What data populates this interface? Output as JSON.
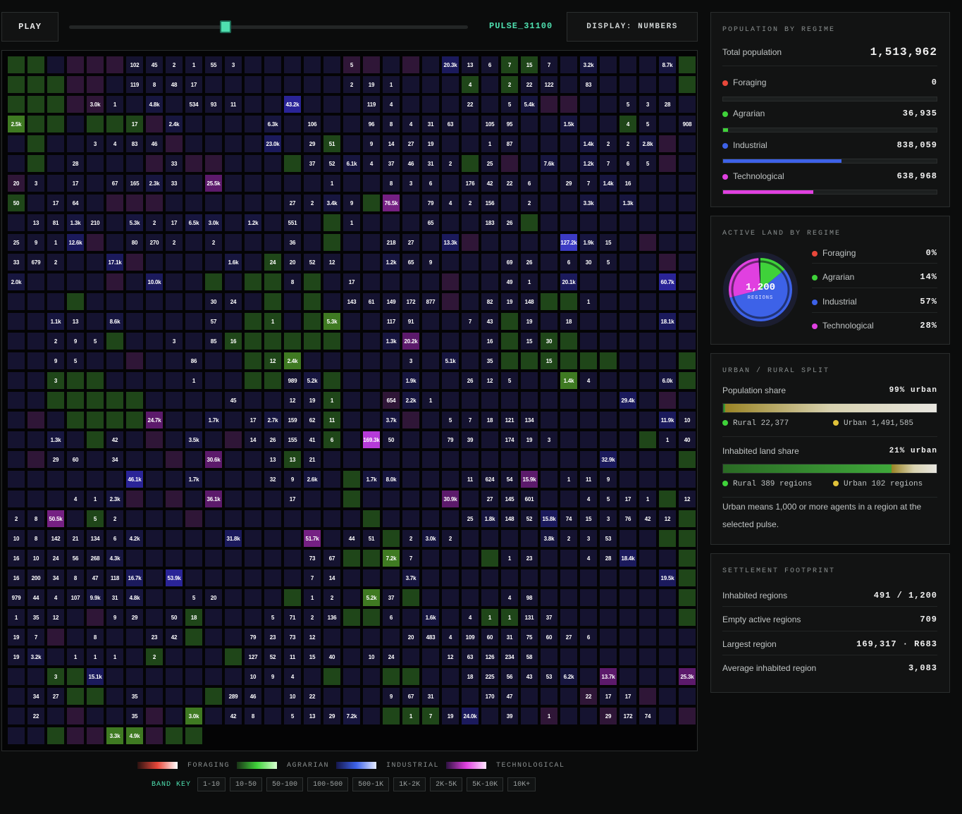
{
  "controls": {
    "play_label": "PLAY",
    "slider_value": 0.393,
    "pulse_label": "PULSE_31100",
    "display_label": "DISPLAY: NUMBERS"
  },
  "colors": {
    "foraging": "#e8473a",
    "agrarian": "#3fd23a",
    "industrial": "#3d62e8",
    "technological": "#e040e0",
    "accent": "#4fe0b0",
    "urban": "#e0c23a"
  },
  "grid": {
    "cols": 35,
    "rows": 35,
    "cells": [
      "G,",
      "G,",
      "I,",
      "T,",
      "T,",
      "T,",
      "I,102",
      "I,45",
      "I,2",
      "I,1",
      "I,55",
      "I,3",
      "I,",
      "I,",
      "I,",
      "I,",
      "I,",
      "T,5",
      "T,",
      "I,",
      "T,",
      "I,",
      "I,20.3k",
      "I,13",
      "I,6",
      "G,7",
      "G,15",
      "I,7",
      "I,",
      "I,3.2k",
      "I,",
      "I,",
      "I,",
      "I,8.7k",
      "G,",
      "G,",
      "G,",
      "G,",
      "T,",
      "T,",
      "I,",
      "I,119",
      "I,8",
      "I,48",
      "I,17",
      "I,",
      "I,",
      "I,",
      "I,",
      "I,",
      "I,",
      "I,",
      "I,2",
      "I,19",
      "I,1",
      "I,",
      "I,",
      "I,",
      "G,4",
      "I,",
      "G,2",
      "I,22",
      "I,122",
      "I,",
      "I,83",
      "I,",
      "I,",
      "I,",
      "I,",
      "G,",
      "G,",
      "G,",
      "G,",
      "T,",
      "T,3.0k",
      "I,1",
      "I,",
      "I,4.8k",
      "I,",
      "I,534",
      "I,93",
      "I,11",
      "I,",
      "I,",
      "I,43.2k",
      "I,",
      "I,",
      "I,",
      "I,119",
      "I,4",
      "I,",
      "I,",
      "I,",
      "I,22",
      "I,",
      "I,5",
      "I,5.4k",
      "T,",
      "T,",
      "I,",
      "I,",
      "I,5",
      "I,3",
      "I,28",
      "I,",
      "G,2.5k",
      "G,",
      "G,",
      "I,",
      "G,",
      "G,",
      "G,17",
      "T,",
      "I,2.4k",
      "I,",
      "I,",
      "I,",
      "I,",
      "I,6.3k",
      "I,",
      "I,106",
      "I,",
      "I,",
      "I,96",
      "I,8",
      "I,4",
      "I,31",
      "I,63",
      "I,",
      "I,105",
      "I,95",
      "I,",
      "I,",
      "I,1.5k",
      "I,",
      "I,",
      "G,4",
      "I,5",
      "I,",
      "I,908",
      "I,",
      "G,",
      "I,",
      "I,",
      "I,3",
      "I,4",
      "I,83",
      "I,46",
      "T,",
      "I,",
      "I,",
      "I,",
      "I,",
      "I,23.0k",
      "I,",
      "I,29",
      "G,51",
      "I,",
      "I,9",
      "I,14",
      "I,27",
      "I,19",
      "I,",
      "I,",
      "I,1",
      "I,87",
      "I,",
      "I,",
      "I,",
      "I,1.4k",
      "I,2",
      "I,2",
      "I,2.8k",
      "T,",
      "I,",
      "I,",
      "G,",
      "I,",
      "I,28",
      "I,",
      "I,",
      "I,",
      "T,",
      "I,33",
      "T,",
      "T,",
      "I,",
      "I,",
      "I,",
      "G,",
      "I,37",
      "I,52",
      "I,6.1k",
      "I,4",
      "I,37",
      "I,46",
      "I,31",
      "I,2",
      "G,",
      "I,25",
      "T,",
      "I,",
      "I,7.6k",
      "I,",
      "I,1.2k",
      "I,7",
      "I,6",
      "I,5",
      "T,",
      "I,",
      "T,20",
      "I,3",
      "I,",
      "I,17",
      "I,",
      "I,67",
      "I,165",
      "I,2.3k",
      "I,33",
      "I,",
      "T,25.5k",
      "I,",
      "I,",
      "I,",
      "I,",
      "I,",
      "I,1",
      "I,",
      "I,",
      "I,8",
      "I,3",
      "I,6",
      "I,",
      "I,176",
      "I,42",
      "I,22",
      "I,6",
      "I,",
      "I,29",
      "I,7",
      "I,1.4k",
      "I,16",
      "I,",
      "I,",
      "I,",
      "G,50",
      "I,",
      "I,17",
      "I,64",
      "I,",
      "T,",
      "T,",
      "T,",
      "I,",
      "I,",
      "I,",
      "I,",
      "I,",
      "I,",
      "I,27",
      "I,2",
      "I,3.4k",
      "I,9",
      "G,",
      "T,76.5k",
      "I,",
      "I,79",
      "I,4",
      "I,2",
      "I,156",
      "I,",
      "I,2",
      "I,",
      "I,",
      "I,3.3k",
      "I,",
      "I,1.3k",
      "I,",
      "I,",
      "I,",
      "I,",
      "I,13",
      "I,81",
      "I,1.3k",
      "I,210",
      "I,",
      "I,5.3k",
      "I,2",
      "I,17",
      "I,6.5k",
      "I,3.0k",
      "I,",
      "I,1.2k",
      "I,",
      "I,551",
      "I,",
      "G,",
      "I,1",
      "I,",
      "I,",
      "I,",
      "I,65",
      "I,",
      "I,",
      "I,183",
      "I,26",
      "G,",
      "I,",
      "I,",
      "I,",
      "I,",
      "I,",
      "I,",
      "I,",
      "I,",
      "I,25",
      "I,9",
      "I,1",
      "I,12.6k",
      "T,",
      "I,",
      "I,80",
      "I,270",
      "I,2",
      "I,",
      "I,2",
      "I,",
      "I,",
      "I,",
      "I,36",
      "I,",
      "G,",
      "I,",
      "I,",
      "I,218",
      "I,27",
      "I,",
      "I,13.3k",
      "T,",
      "I,",
      "I,",
      "I,",
      "I,",
      "I,127.2k",
      "I,1.9k",
      "I,15",
      "I,",
      "T,",
      "I,",
      "I,",
      "I,33",
      "I,679",
      "I,2",
      "I,",
      "I,",
      "I,17.1k",
      "T,",
      "I,",
      "I,",
      "I,",
      "I,",
      "I,1.6k",
      "I,",
      "G,24",
      "I,20",
      "I,52",
      "I,12",
      "I,",
      "I,",
      "I,1.2k",
      "I,65",
      "I,9",
      "I,",
      "I,",
      "I,",
      "I,69",
      "I,26",
      "I,",
      "I,6",
      "I,30",
      "I,5",
      "I,",
      "I,",
      "T,",
      "I,",
      "I,2.0k",
      "I,",
      "I,",
      "I,",
      "I,",
      "T,",
      "I,",
      "I,10.0k",
      "I,",
      "I,",
      "G,",
      "I,",
      "G,",
      "G,",
      "I,8",
      "G,",
      "I,",
      "I,17",
      "I,",
      "I,",
      "I,",
      "I,",
      "T,",
      "I,",
      "I,",
      "I,49",
      "I,1",
      "I,",
      "I,20.1k",
      "I,",
      "I,",
      "I,",
      "I,",
      "I,60.7k",
      "I,",
      "I,",
      "I,",
      "I,",
      "G,",
      "I,",
      "I,",
      "I,",
      "I,",
      "I,",
      "I,",
      "I,30",
      "I,24",
      "I,",
      "G,",
      "I,",
      "G,",
      "I,",
      "I,143",
      "I,61",
      "I,149",
      "I,172",
      "I,877",
      "T,",
      "I,",
      "I,82",
      "I,19",
      "I,148",
      "G,",
      "G,",
      "I,1",
      "I,",
      "I,",
      "I,",
      "I,",
      "I,",
      "I,",
      "I,",
      "I,1.1k",
      "I,13",
      "I,",
      "I,8.6k",
      "I,",
      "I,",
      "I,",
      "I,",
      "I,57",
      "I,",
      "G,",
      "G,1",
      "I,",
      "G,",
      "G,5.3k",
      "I,",
      "I,",
      "I,117",
      "I,91",
      "I,",
      "I,",
      "I,7",
      "I,43",
      "G,",
      "I,19",
      "I,",
      "I,18",
      "I,",
      "I,",
      "I,",
      "I,",
      "I,18.1k",
      "I,",
      "I,",
      "I,",
      "I,2",
      "I,9",
      "I,5",
      "G,",
      "I,",
      "I,",
      "I,3",
      "I,",
      "I,85",
      "G,16",
      "G,",
      "G,",
      "G,",
      "G,",
      "G,",
      "I,",
      "I,",
      "I,1.3k",
      "T,20.2k",
      "I,",
      "I,",
      "I,",
      "I,16",
      "G,",
      "I,15",
      "G,30",
      "G,",
      "I,",
      "I,",
      "I,",
      "I,",
      "I,",
      "I,",
      "I,",
      "I,",
      "I,9",
      "I,5",
      "I,",
      "I,",
      "T,",
      "I,",
      "I,",
      "I,86",
      "I,",
      "I,",
      "G,",
      "G,12",
      "G,2.4k",
      "I,",
      "I,",
      "I,",
      "I,",
      "I,",
      "I,3",
      "I,",
      "I,5.1k",
      "I,",
      "I,35",
      "G,",
      "G,",
      "G,15",
      "G,",
      "G,",
      "G,",
      "I,",
      "I,",
      "I,",
      "G,",
      "I,",
      "I,",
      "G,3",
      "G,",
      "G,",
      "I,",
      "I,",
      "I,",
      "I,",
      "I,1",
      "I,",
      "I,",
      "G,",
      "G,",
      "I,989",
      "I,5.2k",
      "G,",
      "I,",
      "I,",
      "I,",
      "I,1.9k",
      "I,",
      "I,",
      "I,26",
      "I,12",
      "I,5",
      "I,",
      "I,",
      "G,1.4k",
      "I,4",
      "I,",
      "I,",
      "I,",
      "I,6.0k",
      "G,",
      "I,",
      "I,",
      "G,",
      "G,",
      "G,",
      "G,",
      "G,",
      "I,",
      "I,",
      "I,",
      "I,",
      "I,45",
      "I,",
      "I,",
      "I,12",
      "I,19",
      "G,1",
      "I,",
      "I,",
      "T,654",
      "I,2.2k",
      "I,1",
      "I,",
      "I,",
      "I,",
      "I,",
      "I,",
      "I,",
      "I,",
      "I,",
      "I,",
      "I,29.4k",
      "I,",
      "T,",
      "I,",
      "I,",
      "T,",
      "I,",
      "G,",
      "G,",
      "G,",
      "G,",
      "T,24.7k",
      "I,",
      "I,",
      "I,1.7k",
      "I,",
      "I,17",
      "I,2.7k",
      "I,159",
      "I,62",
      "G,11",
      "I,",
      "I,",
      "I,3.7k",
      "T,",
      "I,",
      "I,5",
      "I,7",
      "I,18",
      "I,121",
      "I,134",
      "I,",
      "I,",
      "I,",
      "I,",
      "I,",
      "I,",
      "I,11.9k",
      "I,10",
      "I,",
      "I,",
      "I,1.3k",
      "I,",
      "G,",
      "I,42",
      "I,",
      "T,",
      "I,",
      "I,3.5k",
      "I,",
      "T,",
      "I,14",
      "I,26",
      "I,155",
      "I,41",
      "G,6",
      "I,",
      "T,169.3k",
      "I,50",
      "I,",
      "I,",
      "I,79",
      "I,39",
      "I,",
      "I,174",
      "I,19",
      "I,3",
      "I,",
      "I,",
      "I,",
      "I,",
      "G,",
      "I,1",
      "I,40",
      "I,",
      "T,",
      "I,29",
      "I,60",
      "I,",
      "I,34",
      "I,",
      "I,",
      "T,",
      "I,",
      "T,30.6k",
      "I,",
      "I,",
      "I,13",
      "G,13",
      "I,21",
      "I,",
      "I,",
      "I,",
      "I,",
      "I,",
      "I,",
      "I,",
      "I,",
      "I,",
      "I,",
      "I,",
      "I,",
      "I,",
      "I,",
      "I,32.9k",
      "I,",
      "I,",
      "I,",
      "G,",
      "I,",
      "I,",
      "I,",
      "I,",
      "I,",
      "I,",
      "I,46.1k",
      "I,",
      "I,",
      "I,1.7k",
      "I,",
      "I,",
      "I,",
      "I,32",
      "I,9",
      "I,2.6k",
      "I,",
      "G,",
      "I,1.7k",
      "I,8.0k",
      "I,",
      "I,",
      "I,",
      "I,11",
      "I,624",
      "I,54",
      "T,15.9k",
      "I,",
      "I,1",
      "I,11",
      "I,9",
      "I,",
      "I,",
      "I,",
      "I,",
      "I,",
      "I,",
      "I,",
      "I,4",
      "I,1",
      "I,2.3k",
      "T,",
      "I,",
      "T,",
      "I,",
      "T,36.1k",
      "I,",
      "I,",
      "I,",
      "I,17",
      "I,",
      "I,",
      "G,",
      "I,",
      "I,",
      "I,",
      "I,",
      "T,30.9k",
      "I,",
      "I,27",
      "I,145",
      "I,601",
      "I,",
      "I,",
      "I,4",
      "I,5",
      "I,17",
      "I,1",
      "G,",
      "I,12",
      "I,2",
      "I,8",
      "T,50.5k",
      "I,",
      "G,5",
      "I,2",
      "I,",
      "I,",
      "I,",
      "T,",
      "I,",
      "I,",
      "I,",
      "I,",
      "I,",
      "I,",
      "I,",
      "I,",
      "G,",
      "I,",
      "I,",
      "I,",
      "I,",
      "I,25",
      "I,1.8k",
      "I,148",
      "I,52",
      "I,15.8k",
      "I,74",
      "I,15",
      "I,3",
      "I,76",
      "I,42",
      "I,12",
      "G,",
      "I,10",
      "I,8",
      "I,142",
      "I,21",
      "I,134",
      "I,6",
      "I,4.2k",
      "I,",
      "I,",
      "I,",
      "I,",
      "I,31.8k",
      "I,",
      "I,",
      "I,",
      "T,51.7k",
      "I,",
      "I,44",
      "I,51",
      "G,",
      "I,2",
      "I,3.0k",
      "I,2",
      "I,",
      "I,",
      "I,",
      "I,",
      "I,3.8k",
      "I,2",
      "I,3",
      "I,53",
      "I,",
      "I,",
      "G,",
      "G,",
      "I,16",
      "I,10",
      "I,24",
      "I,56",
      "I,268",
      "I,4.3k",
      "I,",
      "I,",
      "I,",
      "I,",
      "I,",
      "I,",
      "I,",
      "I,",
      "I,",
      "I,73",
      "I,67",
      "G,",
      "G,",
      "G,7.2k",
      "I,7",
      "I,",
      "I,",
      "I,",
      "G,",
      "I,1",
      "I,23",
      "I,",
      "I,",
      "I,4",
      "I,28",
      "I,18.4k",
      "I,",
      "I,",
      "G,",
      "I,16",
      "I,200",
      "I,34",
      "I,8",
      "I,47",
      "I,118",
      "I,16.7k",
      "I,",
      "I,53.9k",
      "I,",
      "I,",
      "I,",
      "I,",
      "I,",
      "I,",
      "I,7",
      "I,14",
      "I,",
      "I,",
      "I,",
      "I,3.7k",
      "I,",
      "I,",
      "I,",
      "I,",
      "I,",
      "I,",
      "I,",
      "I,",
      "I,",
      "I,",
      "I,",
      "I,",
      "I,19.5k",
      "G,",
      "I,979",
      "I,44",
      "I,4",
      "I,107",
      "I,9.9k",
      "I,31",
      "I,4.8k",
      "I,",
      "I,",
      "I,5",
      "I,20",
      "I,",
      "I,",
      "I,",
      "G,",
      "I,1",
      "I,2",
      "I,",
      "G,5.2k",
      "I,37",
      "G,",
      "I,",
      "I,",
      "I,",
      "I,",
      "I,4",
      "I,98",
      "I,",
      "I,",
      "I,",
      "I,",
      "I,",
      "I,",
      "I,",
      "G,",
      "I,1",
      "I,35",
      "I,12",
      "I,",
      "T,",
      "I,9",
      "I,29",
      "I,",
      "I,50",
      "G,18",
      "I,",
      "I,",
      "I,",
      "I,5",
      "I,71",
      "I,2",
      "I,136",
      "G,",
      "G,",
      "I,6",
      "I,",
      "I,1.6k",
      "I,",
      "I,4",
      "G,1",
      "G,1",
      "I,131",
      "I,37",
      "I,",
      "I,",
      "I,",
      "I,",
      "I,",
      "I,",
      "G,",
      "I,19",
      "I,7",
      "T,",
      "I,",
      "I,8",
      "I,",
      "I,",
      "I,23",
      "I,42",
      "G,",
      "I,",
      "I,",
      "I,79",
      "I,23",
      "I,73",
      "I,12",
      "I,",
      "I,",
      "I,",
      "I,",
      "I,20",
      "I,483",
      "I,4",
      "I,109",
      "I,60",
      "I,31",
      "I,75",
      "I,60",
      "I,27",
      "I,6",
      "I,",
      "I,",
      "I,",
      "I,",
      "I,",
      "I,19",
      "I,3.2k",
      "I,",
      "I,1",
      "I,1",
      "I,1",
      "I,",
      "G,2",
      "I,",
      "I,",
      "I,",
      "G,",
      "I,127",
      "I,52",
      "I,11",
      "I,15",
      "I,40",
      "I,",
      "I,10",
      "I,24",
      "I,",
      "I,",
      "I,12",
      "I,63",
      "I,126",
      "I,234",
      "I,58",
      "I,",
      "I,",
      "I,",
      "I,",
      "I,",
      "I,",
      "I,",
      "I,",
      "I,",
      "I,",
      "G,3",
      "G,",
      "I,15.1k",
      "I,",
      "I,",
      "I,",
      "I,",
      "I,",
      "I,",
      "I,",
      "I,10",
      "I,9",
      "I,4",
      "I,",
      "G,",
      "I,",
      "I,",
      "G,",
      "G,",
      "I,",
      "I,",
      "I,18",
      "I,225",
      "I,56",
      "I,43",
      "I,53",
      "I,6.2k",
      "I,",
      "T,13.7k",
      "I,",
      "I,",
      "I,",
      "T,25.3k",
      "I,",
      "I,34",
      "I,27",
      "G,",
      "G,",
      "I,",
      "I,35",
      "I,",
      "I,",
      "I,",
      "G,",
      "I,289",
      "I,46",
      "I,",
      "I,10",
      "I,22",
      "I,",
      "I,",
      "I,",
      "I,9",
      "I,67",
      "I,31",
      "I,",
      "I,",
      "I,170",
      "I,47",
      "I,",
      "I,",
      "I,",
      "T,22",
      "I,17",
      "I,17",
      "T,",
      "I,",
      "I,",
      "I,",
      "I,22",
      "I,",
      "T,",
      "I,",
      "I,",
      "I,35",
      "T,",
      "I,",
      "G,3.0k",
      "I,",
      "I,42",
      "I,8",
      "I,",
      "I,5",
      "I,13",
      "I,29",
      "I,7.2k",
      "I,",
      "G,",
      "G,1",
      "G,7",
      "I,19",
      "I,24.0k",
      "I,",
      "I,39",
      "I,",
      "T,1",
      "I,",
      "I,",
      "T,29",
      "I,172",
      "I,74",
      "I,",
      "T,",
      "I,",
      "I,",
      "G,",
      "T,",
      "T,",
      "G,3.3k",
      "G,4.9k",
      "T,",
      "G,",
      "G,"
    ]
  },
  "legend": {
    "foraging": "FORAGING",
    "agrarian": "AGRARIAN",
    "industrial": "INDUSTRIAL",
    "technological": "TECHNOLOGICAL",
    "band_title": "BAND KEY",
    "bands": [
      "1-10",
      "10-50",
      "50-100",
      "100-500",
      "500-1K",
      "1K-2K",
      "2K-5K",
      "5K-10K",
      "10K+"
    ]
  },
  "population": {
    "title": "POPULATION BY REGIME",
    "total_label": "Total population",
    "total_value": "1,513,962",
    "regimes": [
      {
        "name": "Foraging",
        "value": "0",
        "share": 0.0,
        "color": "#e8473a"
      },
      {
        "name": "Agrarian",
        "value": "36,935",
        "share": 0.024,
        "color": "#3fd23a"
      },
      {
        "name": "Industrial",
        "value": "838,059",
        "share": 0.554,
        "color": "#3d62e8"
      },
      {
        "name": "Technological",
        "value": "638,968",
        "share": 0.422,
        "color": "#e040e0"
      }
    ]
  },
  "land": {
    "title": "ACTIVE LAND BY REGIME",
    "center_value": "1,200",
    "center_label": "REGIONS",
    "regimes": [
      {
        "name": "Foraging",
        "value": "0%",
        "share": 0.0,
        "color": "#e8473a"
      },
      {
        "name": "Agrarian",
        "value": "14%",
        "share": 0.14,
        "color": "#3fd23a"
      },
      {
        "name": "Industrial",
        "value": "57%",
        "share": 0.57,
        "color": "#3d62e8"
      },
      {
        "name": "Technological",
        "value": "28%",
        "share": 0.28,
        "color": "#e040e0"
      }
    ]
  },
  "urban": {
    "title": "URBAN / RURAL SPLIT",
    "pop_label": "Population share",
    "pop_value": "99% urban",
    "pop_urban_share": 0.99,
    "rural_pop": "Rural 22,377",
    "urban_pop": "Urban 1,491,585",
    "land_label": "Inhabited land share",
    "land_value": "21% urban",
    "land_urban_share": 0.21,
    "rural_regions": "Rural 389 regions",
    "urban_regions": "Urban 102 regions",
    "note": "Urban means 1,000 or more agents in a region at the selected pulse."
  },
  "settlement": {
    "title": "SETTLEMENT FOOTPRINT",
    "rows": [
      {
        "label": "Inhabited regions",
        "value": "491 / 1,200"
      },
      {
        "label": "Empty active regions",
        "value": "709"
      },
      {
        "label": "Largest region",
        "value": "169,317 · R683"
      },
      {
        "label": "Average inhabited region",
        "value": "3,083"
      }
    ]
  }
}
